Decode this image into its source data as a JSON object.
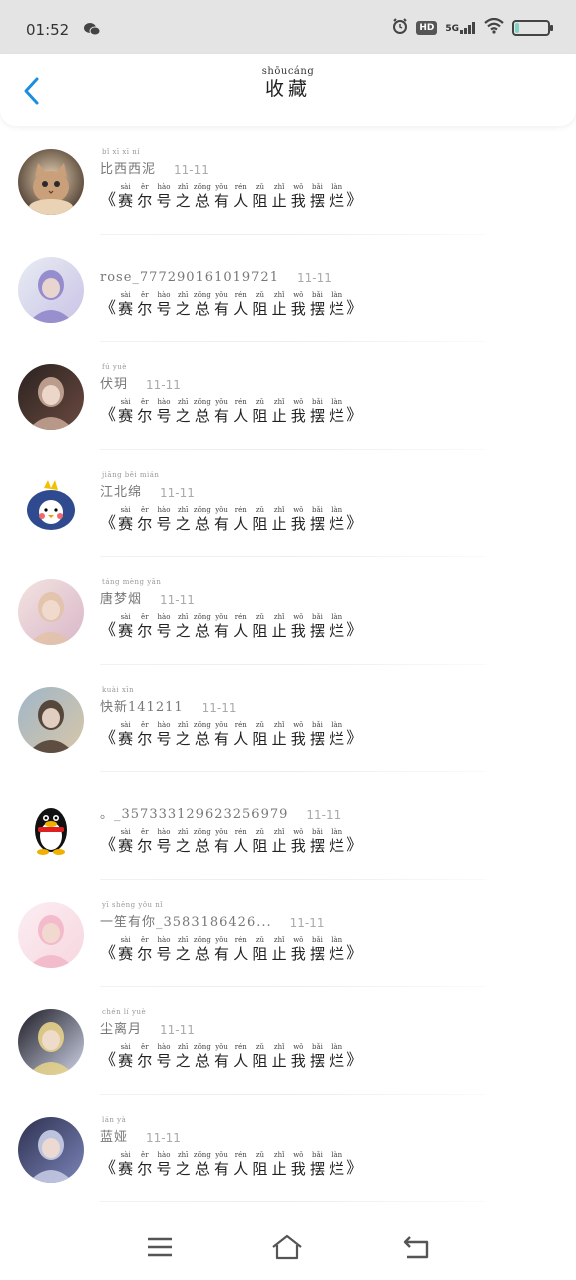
{
  "status_bar": {
    "time": "01:52",
    "network": "5G",
    "hd": "HD",
    "battery_level": 0.12
  },
  "header": {
    "title_pinyin": "shōucáng",
    "title": "收藏",
    "back_icon": "chevron-left-icon"
  },
  "post": {
    "open": "《",
    "close": "》",
    "chars": [
      {
        "py": "sài",
        "hz": "赛"
      },
      {
        "py": "ěr",
        "hz": "尔"
      },
      {
        "py": "hào",
        "hz": "号"
      },
      {
        "py": "zhī",
        "hz": "之"
      },
      {
        "py": "zǒng",
        "hz": "总"
      },
      {
        "py": "yǒu",
        "hz": "有"
      },
      {
        "py": "rén",
        "hz": "人"
      },
      {
        "py": "zǔ",
        "hz": "阻"
      },
      {
        "py": "zhǐ",
        "hz": "止"
      },
      {
        "py": "wǒ",
        "hz": "我"
      },
      {
        "py": "bǎi",
        "hz": "摆"
      },
      {
        "py": "làn",
        "hz": "烂"
      }
    ]
  },
  "items": [
    {
      "name": "比西西泥",
      "pinyin": "bǐ  xī  xī  ní",
      "date": "11-11",
      "avatar": "cat-avatar",
      "colors": [
        "#4a3a2e",
        "#c9a07a",
        "#e9d3b4"
      ]
    },
    {
      "name": "rose_777290161019721",
      "pinyin": "",
      "date": "11-11",
      "avatar": "anime-purple-avatar",
      "colors": [
        "#e8ecf3",
        "#8d84c9",
        "#c9c3e6"
      ]
    },
    {
      "name": "伏玥",
      "pinyin": "fú  yuè",
      "date": "11-11",
      "avatar": "girl-portrait-avatar",
      "colors": [
        "#2a2220",
        "#c9a897",
        "#6b4a40"
      ]
    },
    {
      "name": "江北绵",
      "pinyin": "jiāng běi mián",
      "date": "11-11",
      "avatar": "blue-bird-avatar",
      "colors": [
        "#ffffff",
        "#2f4a8f",
        "#f06a6a"
      ]
    },
    {
      "name": "唐梦烟",
      "pinyin": "táng mèng yān",
      "date": "11-11",
      "avatar": "pastel-girl-avatar",
      "colors": [
        "#f3e3e0",
        "#e2c2a8",
        "#d9b7c9"
      ]
    },
    {
      "name": "快新141211",
      "pinyin": "kuài xīn",
      "date": "11-11",
      "avatar": "anime-boys-avatar",
      "colors": [
        "#9fb6c9",
        "#4b3a2e",
        "#d8c6a8"
      ]
    },
    {
      "name": "。_357333129623256979",
      "pinyin": "",
      "date": "11-11",
      "avatar": "penguin-avatar",
      "colors": [
        "#ffffff",
        "#111111",
        "#f0b000"
      ]
    },
    {
      "name": "一笙有你_3583186426...",
      "pinyin": "yī shēng yǒu  nǐ",
      "date": "11-11",
      "avatar": "pink-bunny-avatar",
      "colors": [
        "#fbeef2",
        "#f2b6c8",
        "#f7d6df"
      ]
    },
    {
      "name": "尘离月",
      "pinyin": "chén  lí  yuè",
      "date": "11-11",
      "avatar": "moon-girl-avatar",
      "colors": [
        "#1b1b24",
        "#e8d38a",
        "#cfd3e6"
      ]
    },
    {
      "name": "蓝娅",
      "pinyin": "lán  yà",
      "date": "11-11",
      "avatar": "hat-girl-avatar",
      "colors": [
        "#2d3150",
        "#c9cfe8",
        "#7b84b8"
      ]
    }
  ],
  "nav": {
    "menu_icon": "menu-icon",
    "home_icon": "home-icon",
    "back_icon": "back-icon"
  }
}
